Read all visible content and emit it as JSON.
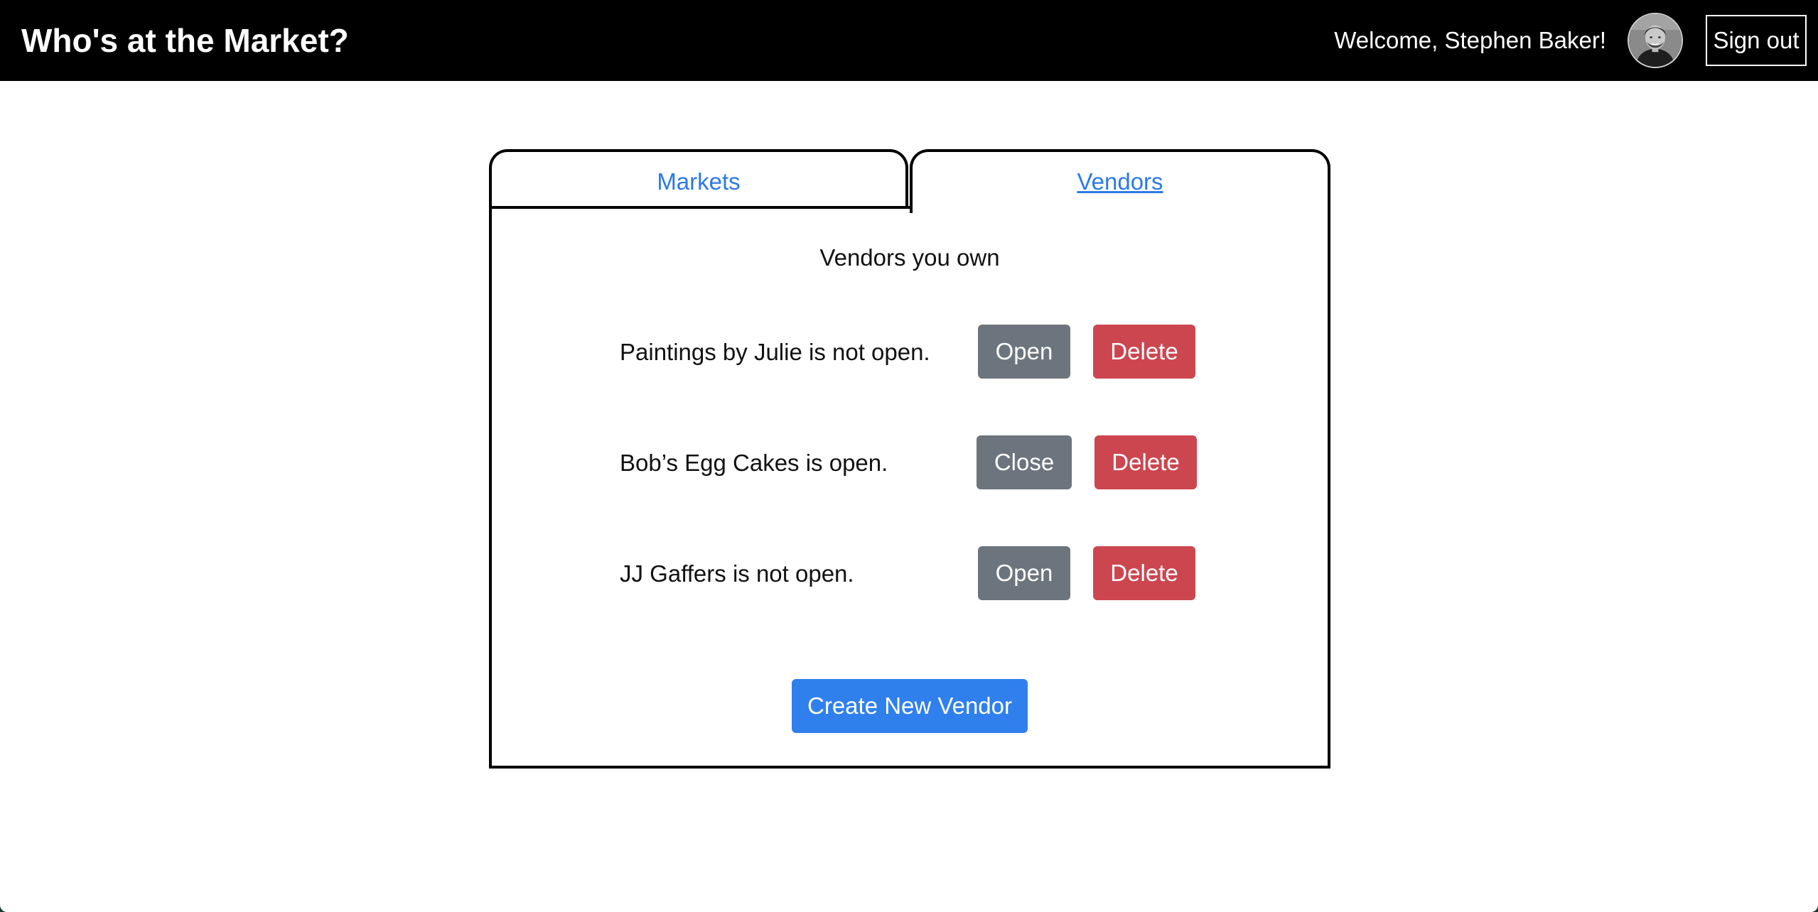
{
  "header": {
    "title": "Who's at the Market?",
    "welcome": "Welcome, Stephen Baker!",
    "avatar_icon": "user-avatar",
    "signout_label": "Sign out"
  },
  "tabs": [
    {
      "label": "Markets",
      "active": false
    },
    {
      "label": "Vendors",
      "active": true
    }
  ],
  "panel": {
    "title": "Vendors you own",
    "vendors": [
      {
        "status": "Paintings by Julie is not open.",
        "toggle_label": "Open",
        "delete_label": "Delete"
      },
      {
        "status": "Bob’s Egg Cakes is open.",
        "toggle_label": "Close",
        "delete_label": "Delete"
      },
      {
        "status": "JJ Gaffers is not open.",
        "toggle_label": "Open",
        "delete_label": "Delete"
      }
    ],
    "create_label": "Create New Vendor"
  },
  "colors": {
    "header_bg": "#000000",
    "link": "#2b79e6",
    "secondary_button": "#6c757d",
    "danger_button": "#cc4650",
    "primary_button": "#2f80ed"
  }
}
